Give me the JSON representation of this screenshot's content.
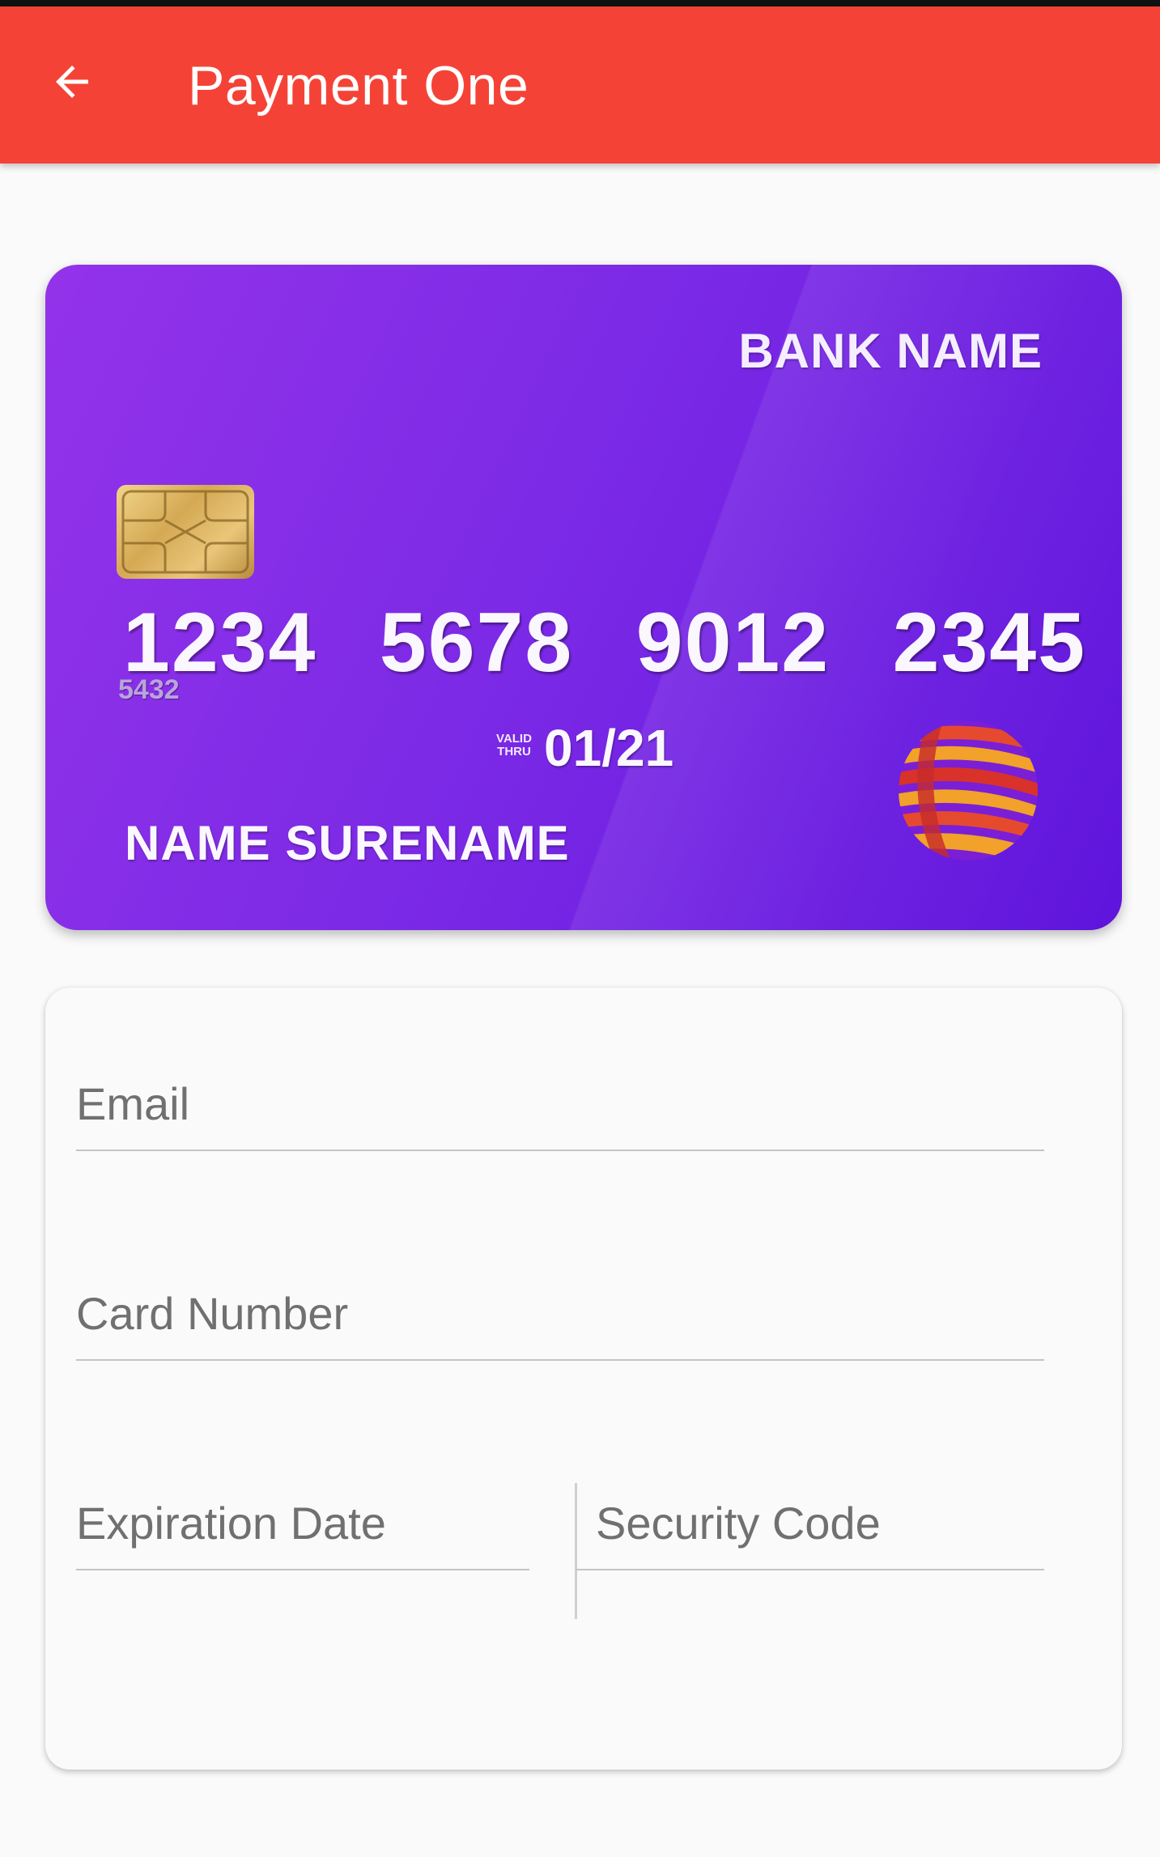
{
  "appbar": {
    "title": "Payment One",
    "back_icon": "arrow-left-icon",
    "color": "#f44336"
  },
  "card": {
    "bank_name": "BANK NAME",
    "number_groups": [
      "1234",
      "5678",
      "9012",
      "2345"
    ],
    "small_number": "5432",
    "valid_label_line1": "VALID",
    "valid_label_line2": "THRU",
    "expiry": "01/21",
    "holder_name": "NAME SURENAME",
    "chip_icon": "chip-icon",
    "network_icon": "globe-logo-icon",
    "color": "#7c2ae6"
  },
  "form": {
    "email_placeholder": "Email",
    "card_number_placeholder": "Card Number",
    "expiration_placeholder": "Expiration Date",
    "security_placeholder": "Security Code"
  }
}
